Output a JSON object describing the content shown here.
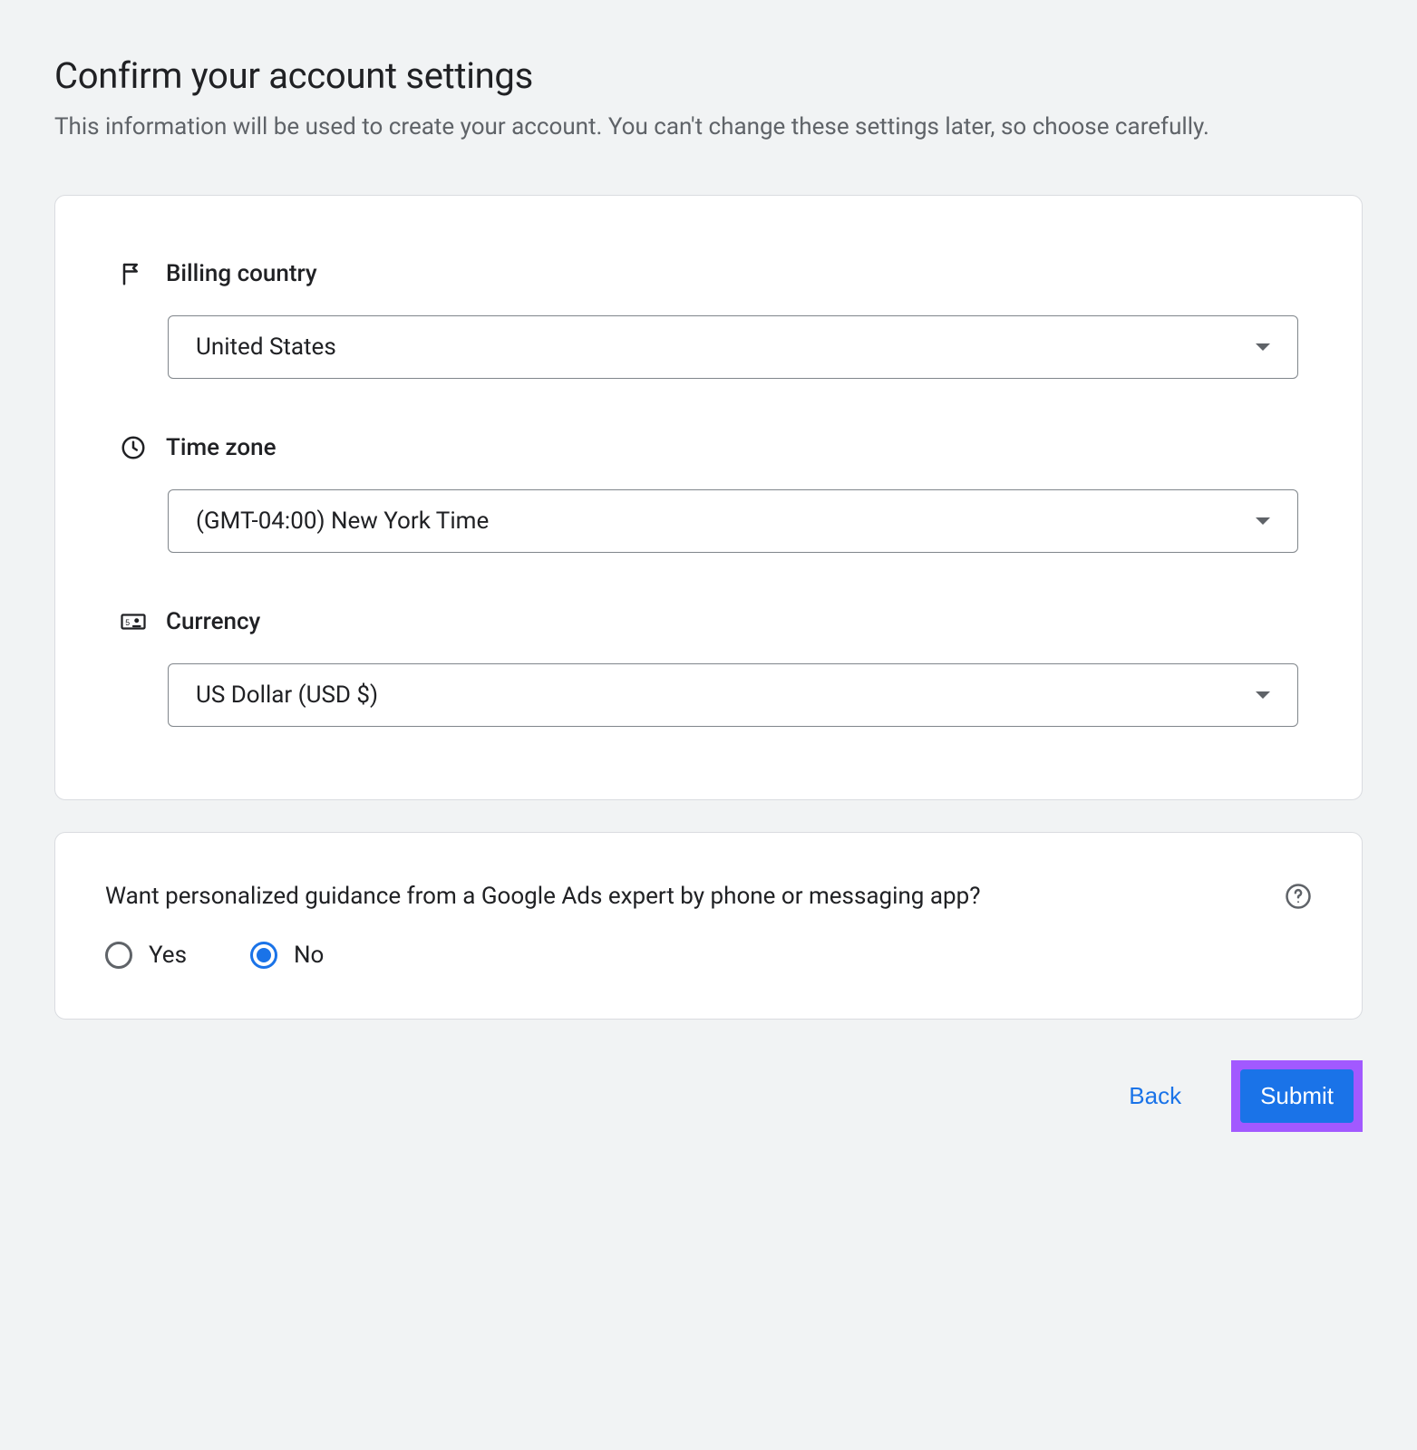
{
  "page": {
    "title": "Confirm your account settings",
    "subtitle": "This information will be used to create your account. You can't change these settings later, so choose carefully."
  },
  "form": {
    "billing_country": {
      "label": "Billing country",
      "value": "United States"
    },
    "time_zone": {
      "label": "Time zone",
      "value": "(GMT-04:00) New York Time"
    },
    "currency": {
      "label": "Currency",
      "value": "US Dollar (USD $)"
    }
  },
  "guidance": {
    "question": "Want personalized guidance from a Google Ads expert by phone or messaging app?",
    "options": {
      "yes": "Yes",
      "no": "No"
    },
    "selected": "no"
  },
  "footer": {
    "back_label": "Back",
    "submit_label": "Submit"
  }
}
